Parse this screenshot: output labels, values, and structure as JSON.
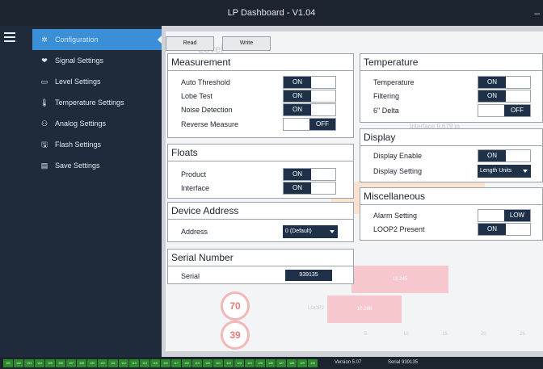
{
  "window": {
    "title": "LP Dashboard - V1.04",
    "minimize": "–"
  },
  "sidebar": {
    "items": [
      {
        "label": "Configuration",
        "icon": "gear-icon",
        "glyph": "✲"
      },
      {
        "label": "Signal Settings",
        "icon": "signal-icon",
        "glyph": "❤"
      },
      {
        "label": "Level Settings",
        "icon": "level-icon",
        "glyph": "▭"
      },
      {
        "label": "Temperature Settings",
        "icon": "thermometer-icon",
        "glyph": "🌡"
      },
      {
        "label": "Analog Settings",
        "icon": "analog-icon",
        "glyph": "⚇"
      },
      {
        "label": "Flash Settings",
        "icon": "flash-icon",
        "glyph": "🖫"
      },
      {
        "label": "Save Settings",
        "icon": "save-icon",
        "glyph": "▤"
      }
    ]
  },
  "toolbar": {
    "read": "Read",
    "write": "Write"
  },
  "background": {
    "level": "Level",
    "interface_reading": "Interface   9.679 in",
    "circle1": "70",
    "circle2": "39",
    "bar1": "15.245",
    "bar2": "10.286",
    "loop2": "LOOP2",
    "axis": [
      "5",
      "10",
      "15",
      "20",
      "25"
    ]
  },
  "measurement": {
    "title": "Measurement",
    "rows": [
      {
        "label": "Auto Threshold",
        "value": "ON"
      },
      {
        "label": "Lobe Test",
        "value": "ON"
      },
      {
        "label": "Noise Detection",
        "value": "ON"
      },
      {
        "label": "Reverse Measure",
        "value": "OFF"
      }
    ]
  },
  "floats": {
    "title": "Floats",
    "rows": [
      {
        "label": "Product",
        "value": "ON"
      },
      {
        "label": "Interface",
        "value": "ON"
      }
    ]
  },
  "device": {
    "title": "Device Address",
    "label": "Address",
    "value": "0 (Default)"
  },
  "serial": {
    "title": "Serial Number",
    "label": "Serial",
    "value": "939135"
  },
  "temperature": {
    "title": "Temperature",
    "rows": [
      {
        "label": "Temperature",
        "value": "ON"
      },
      {
        "label": "Filtering",
        "value": "ON"
      },
      {
        "label": "6\" Delta",
        "value": "OFF"
      }
    ]
  },
  "display": {
    "title": "Display",
    "enable_label": "Display Enable",
    "enable_value": "ON",
    "setting_label": "Display Setting",
    "setting_value": "Length Units"
  },
  "misc": {
    "title": "Miscellaneous",
    "rows": [
      {
        "label": "Alarm Setting",
        "value": "LOW"
      },
      {
        "label": "LOOP2 Present",
        "value": "ON"
      }
    ]
  },
  "statusbar": {
    "leds": [
      "101",
      "102",
      "103",
      "104",
      "105",
      "106",
      "107",
      "108",
      "109",
      "110",
      "111",
      "112",
      "113",
      "114",
      "115",
      "116",
      "117",
      "118",
      "119",
      "120",
      "121",
      "122",
      "123",
      "124",
      "125",
      "126",
      "127",
      "128",
      "129",
      "130"
    ],
    "version": "Version   5.07",
    "serial": "Serial   939135"
  }
}
